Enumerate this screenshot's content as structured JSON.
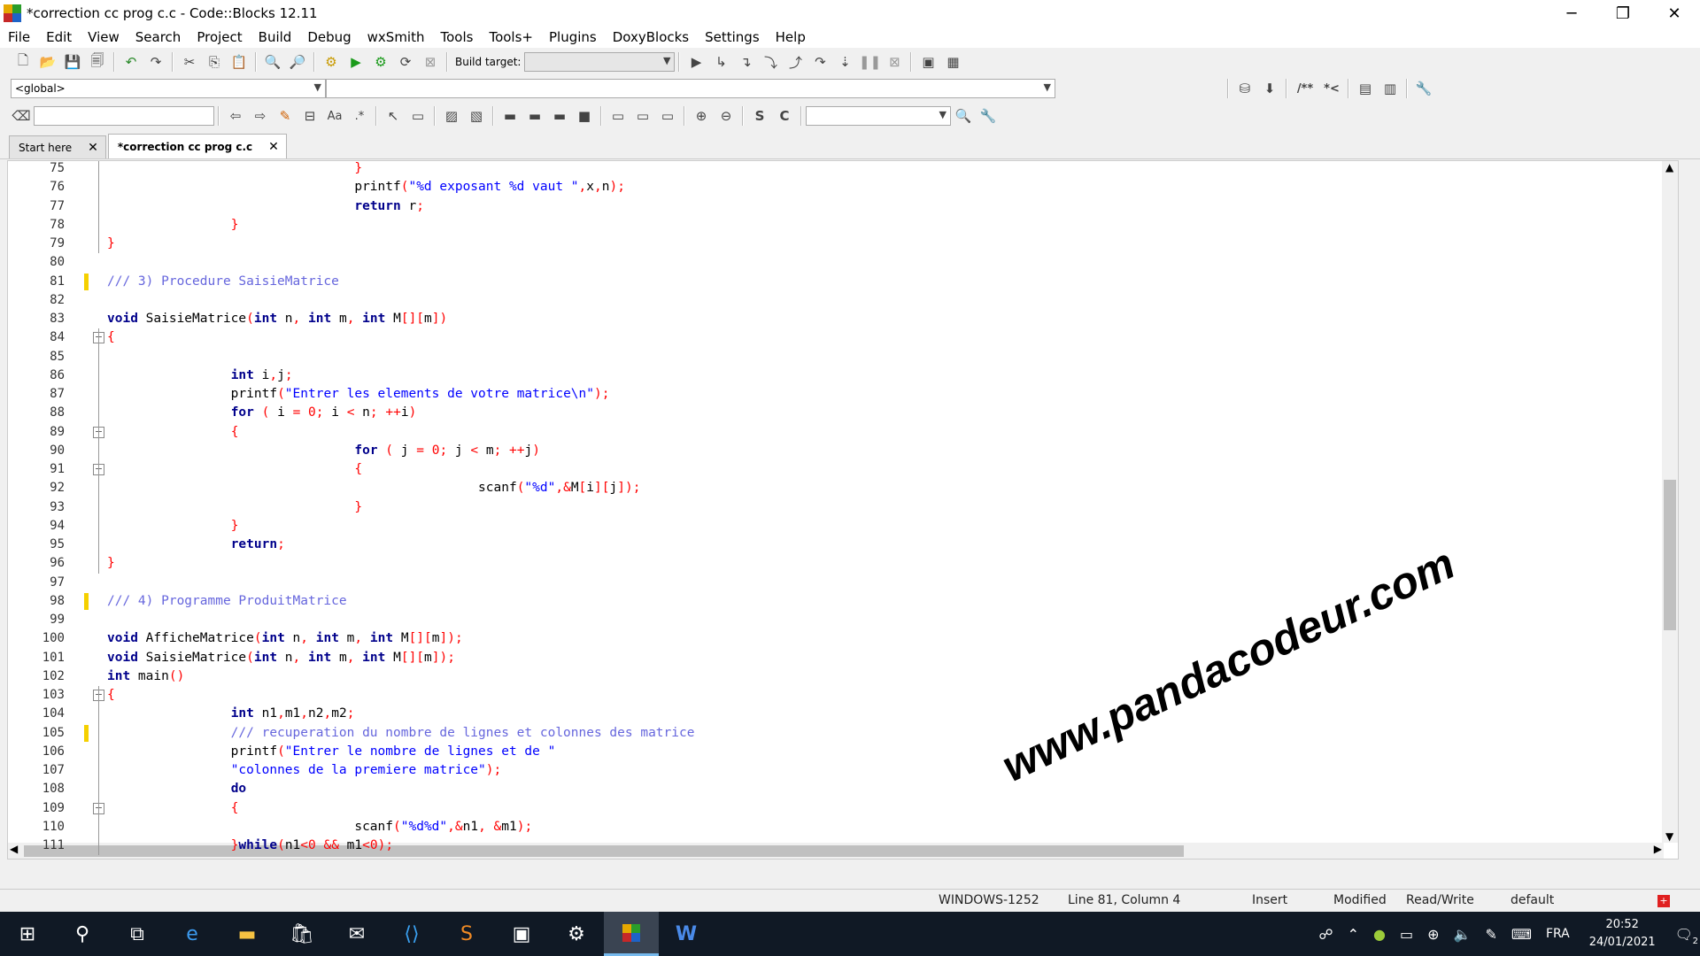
{
  "window": {
    "title": "*correction cc prog c.c - Code::Blocks 12.11",
    "minimize": "─",
    "restore": "❐",
    "close": "✕"
  },
  "menu": [
    "File",
    "Edit",
    "View",
    "Search",
    "Project",
    "Build",
    "Debug",
    "wxSmith",
    "Tools",
    "Tools+",
    "Plugins",
    "DoxyBlocks",
    "Settings",
    "Help"
  ],
  "toolbar": {
    "build_target_label": "Build target:",
    "build_target_value": ""
  },
  "scope": {
    "value": "<global>",
    "function_value": ""
  },
  "doxy": {
    "block_comment": "/**",
    "line_comment": "*<"
  },
  "search": {
    "value": "",
    "find_value": ""
  },
  "tabs": [
    {
      "label": "Start here",
      "close": "✕"
    },
    {
      "label": "*correction cc prog c.c",
      "close": "✕"
    }
  ],
  "editor": {
    "lines": [
      {
        "n": "75",
        "code": "                                }"
      },
      {
        "n": "76",
        "code": "                                printf(\"%d exposant %d vaut \",x,n);"
      },
      {
        "n": "77",
        "code": "                                return r;"
      },
      {
        "n": "78",
        "code": "                }"
      },
      {
        "n": "79",
        "code": "}"
      },
      {
        "n": "80",
        "code": ""
      },
      {
        "n": "81",
        "code": "/// 3) Procedure SaisieMatrice"
      },
      {
        "n": "82",
        "code": ""
      },
      {
        "n": "83",
        "code": "void SaisieMatrice(int n, int m, int M[][m])"
      },
      {
        "n": "84",
        "code": "{"
      },
      {
        "n": "85",
        "code": ""
      },
      {
        "n": "86",
        "code": "                int i,j;"
      },
      {
        "n": "87",
        "code": "                printf(\"Entrer les elements de votre matrice\\n\");"
      },
      {
        "n": "88",
        "code": "                for ( i = 0; i < n; ++i)"
      },
      {
        "n": "89",
        "code": "                {"
      },
      {
        "n": "90",
        "code": "                                for ( j = 0; j < m; ++j)"
      },
      {
        "n": "91",
        "code": "                                {"
      },
      {
        "n": "92",
        "code": "                                                scanf(\"%d\",&M[i][j]);"
      },
      {
        "n": "93",
        "code": "                                }"
      },
      {
        "n": "94",
        "code": "                }"
      },
      {
        "n": "95",
        "code": "                return;"
      },
      {
        "n": "96",
        "code": "}"
      },
      {
        "n": "97",
        "code": ""
      },
      {
        "n": "98",
        "code": "/// 4) Programme ProduitMatrice"
      },
      {
        "n": "99",
        "code": ""
      },
      {
        "n": "100",
        "code": "void AfficheMatrice(int n, int m, int M[][m]);"
      },
      {
        "n": "101",
        "code": "void SaisieMatrice(int n, int m, int M[][m]);"
      },
      {
        "n": "102",
        "code": "int main()"
      },
      {
        "n": "103",
        "code": "{"
      },
      {
        "n": "104",
        "code": "                int n1,m1,n2,m2;"
      },
      {
        "n": "105",
        "code": "                /// recuperation du nombre de lignes et colonnes des matrice"
      },
      {
        "n": "106",
        "code": "                printf(\"Entrer le nombre de lignes et de \""
      },
      {
        "n": "107",
        "code": "                \"colonnes de la premiere matrice\");"
      },
      {
        "n": "108",
        "code": "                do"
      },
      {
        "n": "109",
        "code": "                {"
      },
      {
        "n": "110",
        "code": "                                scanf(\"%d%d\",&n1, &m1);"
      },
      {
        "n": "111",
        "code": "                }while(n1<0 && m1<0);"
      }
    ]
  },
  "watermark": "www.pandacodeur.com",
  "status": {
    "encoding": "WINDOWS-1252",
    "position": "Line 81, Column 4",
    "mode": "Insert",
    "modified": "Modified",
    "access": "Read/Write",
    "profile": "default"
  },
  "taskbar": {
    "lang": "FRA",
    "time": "20:52",
    "date": "24/01/2021",
    "notifications": "2"
  }
}
